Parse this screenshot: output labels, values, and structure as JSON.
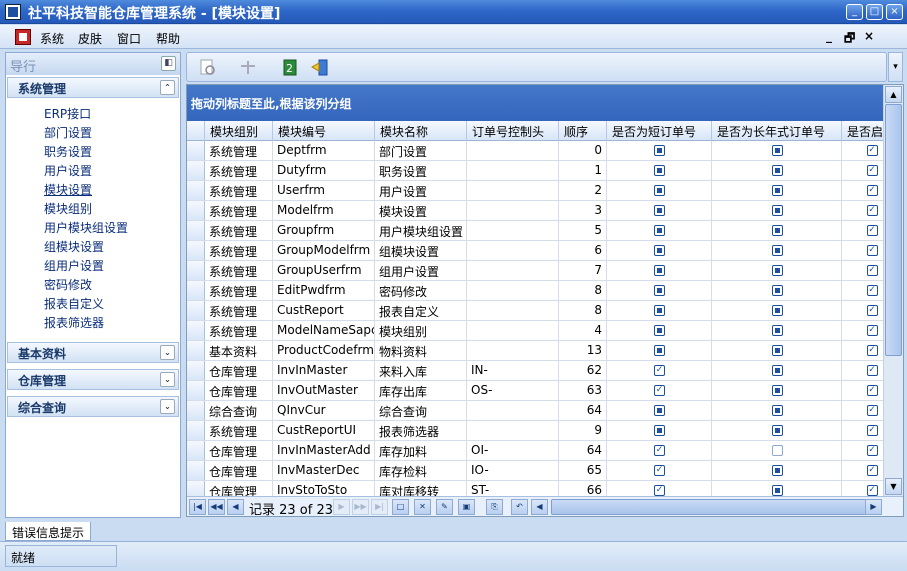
{
  "window": {
    "title": "社平科技智能仓库管理系统 - [模块设置]",
    "min_icon": "minimize-icon",
    "max_icon": "maximize-icon",
    "close_icon": "close-icon"
  },
  "menu": {
    "items": [
      "系统",
      "皮肤",
      "窗口",
      "帮助"
    ],
    "mdi": {
      "minimize": "_",
      "restore": "🗗",
      "close": "×"
    }
  },
  "nav": {
    "header": "导行",
    "groups": [
      {
        "title": "系统管理",
        "expanded": true,
        "items": [
          "ERP接口",
          "部门设置",
          "职务设置",
          "用户设置",
          "模块设置",
          "模块组别",
          "用户模块组设置",
          "组模块设置",
          "组用户设置",
          "密码修改",
          "报表自定义",
          "报表筛选器"
        ],
        "active": "模块设置"
      },
      {
        "title": "基本资料",
        "expanded": false
      },
      {
        "title": "仓库管理",
        "expanded": false
      },
      {
        "title": "综合查询",
        "expanded": false
      }
    ]
  },
  "grid": {
    "group_panel_text": "拖动列标题至此,根据该列分组",
    "columns": [
      "模块组别",
      "模块编号",
      "模块名称",
      "订单号控制头",
      "顺序",
      "是否为短订单号",
      "是否为长年式订单号",
      "是否启"
    ],
    "rows": [
      {
        "group": "系统管理",
        "code": "Deptfrm",
        "name": "部门设置",
        "prefix": "",
        "order": "0",
        "short": "dot",
        "long": "dot",
        "enabled": "check"
      },
      {
        "group": "系统管理",
        "code": "Dutyfrm",
        "name": "职务设置",
        "prefix": "",
        "order": "1",
        "short": "dot",
        "long": "dot",
        "enabled": "check"
      },
      {
        "group": "系统管理",
        "code": "Userfrm",
        "name": "用户设置",
        "prefix": "",
        "order": "2",
        "short": "dot",
        "long": "dot",
        "enabled": "check"
      },
      {
        "group": "系统管理",
        "code": "Modelfrm",
        "name": "模块设置",
        "prefix": "",
        "order": "3",
        "short": "dot",
        "long": "dot",
        "enabled": "check"
      },
      {
        "group": "系统管理",
        "code": "Groupfrm",
        "name": "用户模块组设置",
        "prefix": "",
        "order": "5",
        "short": "dot",
        "long": "dot",
        "enabled": "check"
      },
      {
        "group": "系统管理",
        "code": "GroupModelfrm",
        "name": "组模块设置",
        "prefix": "",
        "order": "6",
        "short": "dot",
        "long": "dot",
        "enabled": "check"
      },
      {
        "group": "系统管理",
        "code": "GroupUserfrm",
        "name": "组用户设置",
        "prefix": "",
        "order": "7",
        "short": "dot",
        "long": "dot",
        "enabled": "check"
      },
      {
        "group": "系统管理",
        "code": "EditPwdfrm",
        "name": "密码修改",
        "prefix": "",
        "order": "8",
        "short": "dot",
        "long": "dot",
        "enabled": "check"
      },
      {
        "group": "系统管理",
        "code": "CustReport",
        "name": "报表自定义",
        "prefix": "",
        "order": "8",
        "short": "dot",
        "long": "dot",
        "enabled": "check"
      },
      {
        "group": "系统管理",
        "code": "ModelNameSapce",
        "name": "模块组别",
        "prefix": "",
        "order": "4",
        "short": "dot",
        "long": "dot",
        "enabled": "check"
      },
      {
        "group": "基本资料",
        "code": "ProductCodefrm",
        "name": "物料资料",
        "prefix": "",
        "order": "13",
        "short": "dot",
        "long": "dot",
        "enabled": "check"
      },
      {
        "group": "仓库管理",
        "code": "InvInMaster",
        "name": "来料入库",
        "prefix": "IN-",
        "order": "62",
        "short": "check",
        "long": "dot",
        "enabled": "check"
      },
      {
        "group": "仓库管理",
        "code": "InvOutMaster",
        "name": "库存出库",
        "prefix": "OS-",
        "order": "63",
        "short": "check",
        "long": "dot",
        "enabled": "check"
      },
      {
        "group": "综合查询",
        "code": "QInvCur",
        "name": "综合查询",
        "prefix": "",
        "order": "64",
        "short": "dot",
        "long": "dot",
        "enabled": "check"
      },
      {
        "group": "系统管理",
        "code": "CustReportUI",
        "name": "报表筛选器",
        "prefix": "",
        "order": "9",
        "short": "dot",
        "long": "dot",
        "enabled": "check"
      },
      {
        "group": "仓库管理",
        "code": "InvInMasterAdd",
        "name": "库存加料",
        "prefix": "OI-",
        "order": "64",
        "short": "check",
        "long": "empty",
        "enabled": "check"
      },
      {
        "group": "仓库管理",
        "code": "InvMasterDec",
        "name": "库存检料",
        "prefix": "IO-",
        "order": "65",
        "short": "check",
        "long": "dot",
        "enabled": "check"
      },
      {
        "group": "仓库管理",
        "code": "InvStoToSto",
        "name": "库对库移转",
        "prefix": "ST-",
        "order": "66",
        "short": "check",
        "long": "dot",
        "enabled": "check"
      }
    ],
    "navigator": {
      "record_text": "记录 23 of 23"
    }
  },
  "error_tab": "错误信息提示",
  "status": "就绪",
  "colors": {
    "accent": "#2e67c8",
    "group_panel": "#3a6ec3"
  }
}
